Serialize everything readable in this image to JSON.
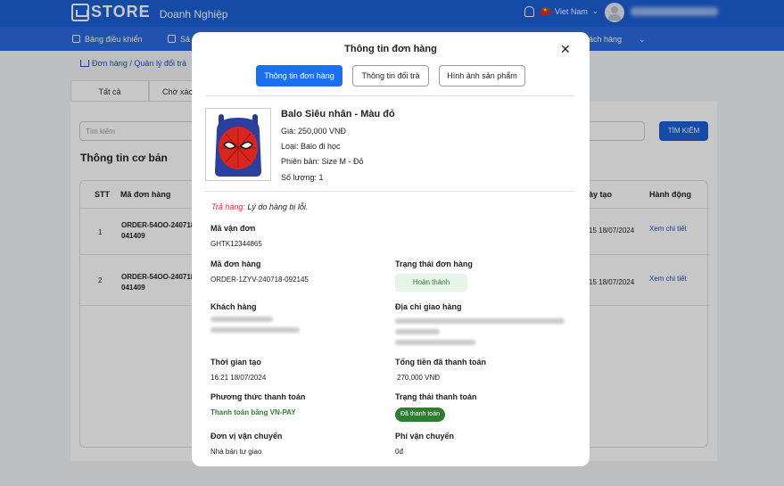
{
  "app": {
    "logo_text": "STORE",
    "logo_sub": "Doanh Nghiệp",
    "language": "Viet Nam"
  },
  "nav": {
    "dashboard": "Bảng điều khiển",
    "products_partial": "Sả",
    "orders_partial": "ách hàng"
  },
  "breadcrumb": "Đơn hàng / Quản lý đổi trả",
  "tabs": [
    "Tất cả",
    "Chờ xác"
  ],
  "search": {
    "placeholder": "Tìm kiếm",
    "button": "TÌM KIẾM"
  },
  "section_title": "Thông tin cơ bản",
  "table": {
    "headers": {
      "stt": "STT",
      "order_code": "Mã đơn hàng",
      "date_partial": "ày tạo",
      "action": "Hành động"
    },
    "rows": [
      {
        "stt": "1",
        "order_line1": "ORDER-54OO-240718-",
        "order_line2": "041409",
        "date": "15 18/07/2024",
        "action": "Xem chi tiết"
      },
      {
        "stt": "2",
        "order_line1": "ORDER-54OO-240718-",
        "order_line2": "041409",
        "date": "15 18/07/2024",
        "action": "Xem chi tiết"
      }
    ]
  },
  "modal": {
    "title": "Thông tin đơn hàng",
    "tabs": [
      "Thông tin đơn hàng",
      "Thông tin đổi trả",
      "Hình ảnh sản phẩm"
    ],
    "product": {
      "name": "Balo Siêu nhân - Màu đỏ",
      "price": "Giá: 250,000 VNĐ",
      "type": "Loại: Balo đi học",
      "variant": "Phiên bản: Size M - Đỏ",
      "quantity": "Số lượng: 1"
    },
    "return_label": "Trả hàng:",
    "return_reason": "Lý do hàng bị lỗi.",
    "fields": {
      "tracking_label": "Mã vận đơn",
      "tracking_value": "GHTK12344865",
      "order_label": "Mã đơn hàng",
      "order_value": "ORDER-1ZYV-240718-092145",
      "order_status_label": "Trạng thái đơn hàng",
      "order_status_value": "Hoàn thành",
      "customer_label": "Khách hàng",
      "address_label": "Địa chỉ giao hàng",
      "created_label": "Thời gian tạo",
      "created_value": "16:21 18/07/2024",
      "total_label": "Tổng tiền đã thanh toán",
      "total_value": "270,000 VNĐ",
      "payment_method_label": "Phương thức thanh toán",
      "payment_method_value": "Thanh toán bằng VN-PAY",
      "payment_status_label": "Trạng thái thanh toán",
      "payment_status_value": "Đã thanh toán",
      "shipping_unit_label": "Đơn vị vận chuyển",
      "shipping_unit_value": "Nhà bán tự giao",
      "shipping_fee_label": "Phí vận chuyển",
      "shipping_fee_value": "0đ"
    }
  },
  "colors": {
    "primary": "#1b5fd6",
    "active_tab": "#1b6ff0",
    "success": "#2e7d32",
    "return_red": "#d32f2f"
  }
}
